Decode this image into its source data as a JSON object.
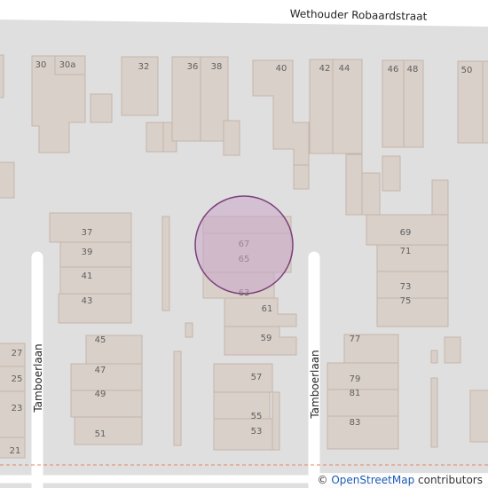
{
  "map": {
    "streets": {
      "top": "Wethouder Robaardstraat",
      "left": "Tamboerlaan",
      "center": "Tamboerlaan"
    },
    "house_numbers": {
      "n30": "30",
      "n30a": "30a",
      "n32": "32",
      "n36": "36",
      "n38": "38",
      "n40": "40",
      "n42": "42",
      "n44": "44",
      "n46": "46",
      "n48": "48",
      "n50": "50",
      "n37": "37",
      "n39": "39",
      "n41": "41",
      "n43": "43",
      "n45": "45",
      "n47": "47",
      "n49": "49",
      "n51": "51",
      "n27": "27",
      "n25": "25",
      "n23": "23",
      "n21": "21",
      "n67": "67",
      "n65": "65",
      "n63": "63",
      "n61": "61",
      "n59": "59",
      "n57": "57",
      "n55": "55",
      "n53": "53",
      "n69": "69",
      "n71": "71",
      "n73": "73",
      "n75": "75",
      "n77": "77",
      "n79": "79",
      "n81": "81",
      "n83": "83"
    },
    "marker": {
      "fill": "#c9a6c9",
      "stroke": "#7b3f7b"
    },
    "colors": {
      "background": "#e0dfdf",
      "building": "#d9d0c9",
      "building_outline": "#c4b6ab",
      "road": "#ffffff",
      "boundary": "#e6866a"
    }
  },
  "attribution": {
    "symbol": "©",
    "link_text": "OpenStreetMap",
    "suffix": "contributors"
  }
}
